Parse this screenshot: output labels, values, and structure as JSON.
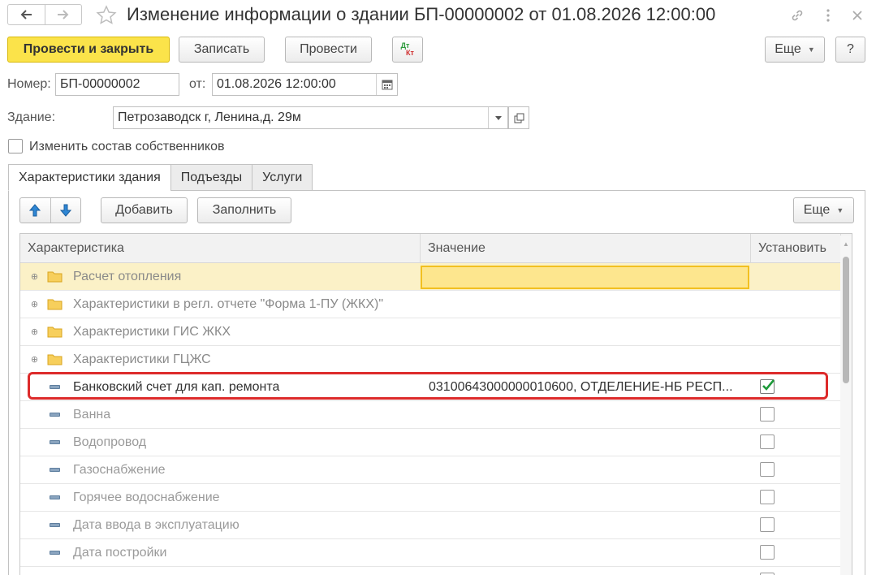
{
  "window": {
    "title": "Изменение информации о здании БП-00000002 от 01.08.2026 12:00:00"
  },
  "toolbar": {
    "post_close_label": "Провести и закрыть",
    "save_label": "Записать",
    "post_label": "Провести",
    "dtkt_top": "Дт",
    "dtkt_bottom": "Кт",
    "more_label": "Еще",
    "help_label": "?"
  },
  "form": {
    "number_label": "Номер:",
    "number_value": "БП-00000002",
    "date_label": "от:",
    "date_value": "01.08.2026 12:00:00",
    "building_label": "Здание:",
    "building_value": "Петрозаводск г, Ленина,д. 29м",
    "change_owners_label": "Изменить состав собственников"
  },
  "tabs": [
    {
      "label": "Характеристики здания",
      "active": true
    },
    {
      "label": "Подъезды",
      "active": false
    },
    {
      "label": "Услуги",
      "active": false
    }
  ],
  "grid_toolbar": {
    "add_label": "Добавить",
    "fill_label": "Заполнить",
    "more_label": "Еще"
  },
  "grid": {
    "columns": [
      "Характеристика",
      "Значение",
      "Установить"
    ],
    "rows": [
      {
        "name": "Расчет отопления",
        "value": "",
        "kind": "group",
        "set": null
      },
      {
        "name": "Характеристики в регл. отчете \"Форма 1-ПУ (ЖКХ)\"",
        "value": "",
        "kind": "group",
        "set": null
      },
      {
        "name": "Характеристики ГИС ЖКХ",
        "value": "",
        "kind": "group",
        "set": null
      },
      {
        "name": "Характеристики ГЦЖС",
        "value": "",
        "kind": "group",
        "set": null
      },
      {
        "name": "Банковский счет для кап. ремонта",
        "value": "03100643000000010600, ОТДЕЛЕНИЕ-НБ РЕСП...",
        "kind": "item",
        "set": true
      },
      {
        "name": "Ванна",
        "value": "",
        "kind": "item",
        "set": false
      },
      {
        "name": "Водопровод",
        "value": "",
        "kind": "item",
        "set": false
      },
      {
        "name": "Газоснабжение",
        "value": "",
        "kind": "item",
        "set": false
      },
      {
        "name": "Горячее водоснабжение",
        "value": "",
        "kind": "item",
        "set": false
      },
      {
        "name": "Дата ввода в эксплуатацию",
        "value": "",
        "kind": "item",
        "set": false
      },
      {
        "name": "Дата постройки",
        "value": "",
        "kind": "item",
        "set": false
      }
    ]
  },
  "colors": {
    "primary_button": "#fbe34a",
    "selected_row": "#fbf1c7",
    "highlight_border": "#dd2b2b",
    "checkmark": "#1e9a3a"
  }
}
